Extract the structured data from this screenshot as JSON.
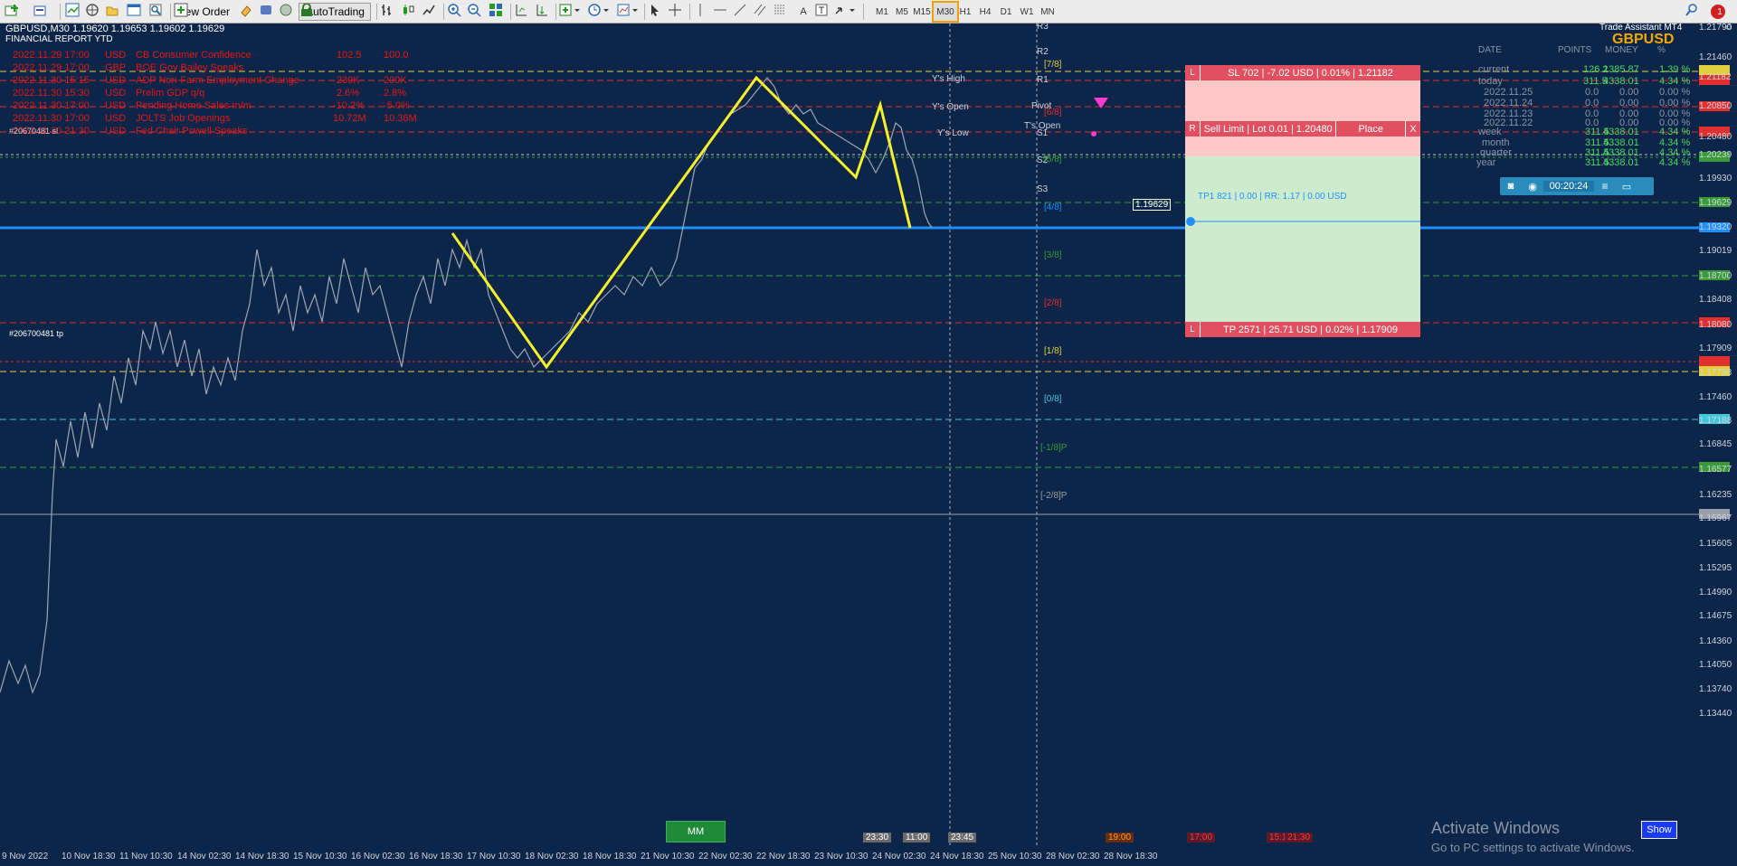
{
  "toolbar": {
    "new_order": "New Order",
    "autotrading": "AutoTrading",
    "timeframes": [
      "M1",
      "M5",
      "M15",
      "M30",
      "H1",
      "H4",
      "D1",
      "W1",
      "MN"
    ],
    "active_timeframe": "M30",
    "badge": "1"
  },
  "chart": {
    "symbol_header": "GBPUSD,M30  1.19620 1.19653 1.19602 1.19629",
    "report_title": "FINANCIAL REPORT YTD",
    "trade_assistant": "Trade Assistant MT4",
    "pair": "GBPUSD",
    "order_label_top": "#20670481 sl",
    "order_label_tp": "#206700481 tp",
    "activate_title": "Activate Windows",
    "activate_sub": "Go to PC settings to activate Windows.",
    "show_button": "Show",
    "mm_button": "MM",
    "current_price": "1.19629"
  },
  "news": [
    {
      "time": "2022.11.29 17:00",
      "currency": "USD",
      "event": "CB Consumer Confidence",
      "actual": "102.5",
      "forecast": "100.0"
    },
    {
      "time": "2022.11.29 17:00",
      "currency": "GBP",
      "event": "BOE Gov Bailey Speaks",
      "actual": "",
      "forecast": ""
    },
    {
      "time": "2022.11.30 15:15",
      "currency": "USD",
      "event": "ADP Non-Farm Employment Change",
      "actual": "239K",
      "forecast": "200K"
    },
    {
      "time": "2022.11.30 15:30",
      "currency": "USD",
      "event": "Prelim GDP q/q",
      "actual": "2.6%",
      "forecast": "2.8%"
    },
    {
      "time": "2022.11.30 17:00",
      "currency": "USD",
      "event": "Pending Home Sales m/m",
      "actual": "-10.2%",
      "forecast": "-5.0%"
    },
    {
      "time": "2022.11.30 17:00",
      "currency": "USD",
      "event": "JOLTS Job Openings",
      "actual": "10.72M",
      "forecast": "10.36M"
    },
    {
      "time": "2022.11.30 21:30",
      "currency": "USD",
      "event": "Fed Chair Powell Speaks",
      "actual": "",
      "forecast": ""
    }
  ],
  "pivots": {
    "r3": "R3",
    "r2": "R2",
    "r1": "R1",
    "pivot": "Pivot",
    "s1": "S1",
    "s2": "S2",
    "s3": "S3",
    "ys_high": "Y's High",
    "ys_open": "Y's Open",
    "ts_open": "T's Open",
    "ys_low": "Y's Low"
  },
  "murrey": [
    "[7/8]",
    "[6/8]",
    "[5/8]",
    "[4/8]",
    "[3/8]",
    "[2/8]",
    "[1/8]",
    "[0/8]",
    "[-1/8]P",
    "[-2/8]P"
  ],
  "trade_panel": {
    "sl_bar": "SL 702 | -7.02 USD | 0.01% | 1.21182",
    "sell_limit": "Sell Limit | Lot 0.01 | 1.20480",
    "place": "Place",
    "close": "X",
    "r": "R",
    "l": "L",
    "tp1": "TP1 821 | 0.00 | RR: 1.17 | 0.00 USD",
    "tp_bar": "TP 2571 | 25.71 USD | 0.02% | 1.17909"
  },
  "stats": {
    "headers": [
      "DATE",
      "POINTS",
      "MONEY",
      "%"
    ],
    "rows": [
      {
        "label": "current",
        "points": "126.2",
        "money": "1385.87",
        "pct": "1.39 %",
        "color": "#4cd964"
      },
      {
        "label": "today",
        "points": "311.5",
        "money": "4338.01",
        "pct": "4.34 %",
        "color": "#4cd964"
      },
      {
        "label": "2022.11.25",
        "points": "0.0",
        "money": "0.00",
        "pct": "0.00 %",
        "color": "#8a96a8"
      },
      {
        "label": "2022.11.24",
        "points": "0.0",
        "money": "0.00",
        "pct": "0.00 %",
        "color": "#8a96a8"
      },
      {
        "label": "2022.11.23",
        "points": "0.0",
        "money": "0.00",
        "pct": "0.00 %",
        "color": "#8a96a8"
      },
      {
        "label": "2022.11.22",
        "points": "0.0",
        "money": "0.00",
        "pct": "0.00 %",
        "color": "#8a96a8"
      },
      {
        "label": "week",
        "points": "311.5",
        "money": "4338.01",
        "pct": "4.34 %",
        "color": "#4cd964"
      },
      {
        "label": "month",
        "points": "311.5",
        "money": "4338.01",
        "pct": "4.34 %",
        "color": "#4cd964"
      },
      {
        "label": "quarter",
        "points": "311.5",
        "money": "4338.01",
        "pct": "4.34 %",
        "color": "#4cd964"
      },
      {
        "label": "year",
        "points": "311.5",
        "money": "4338.01",
        "pct": "4.34 %",
        "color": "#4cd964"
      }
    ],
    "timer": "00:20:24"
  },
  "price_scale": [
    "1.21790",
    "1.21460",
    "1.21182",
    "1.20850",
    "1.20480",
    "1.20239",
    "1.19930",
    "1.19629",
    "1.19320",
    "1.19019",
    "1.18700",
    "1.18408",
    "1.18080",
    "1.17909",
    "1.17798",
    "1.17460",
    "1.17188",
    "1.16845",
    "1.16577",
    "1.16235",
    "1.15967",
    "1.15605",
    "1.15295",
    "1.14990",
    "1.14675",
    "1.14360",
    "1.14050",
    "1.13740",
    "1.13440"
  ],
  "time_axis": [
    "9 Nov 2022",
    "10 Nov 18:30",
    "11 Nov 10:30",
    "14 Nov 02:30",
    "14 Nov 18:30",
    "15 Nov 10:30",
    "16 Nov 02:30",
    "16 Nov 18:30",
    "17 Nov 10:30",
    "18 Nov 02:30",
    "18 Nov 18:30",
    "21 Nov 10:30",
    "22 Nov 02:30",
    "22 Nov 18:30",
    "23 Nov 10:30",
    "24 Nov 02:30",
    "24 Nov 18:30",
    "25 Nov 10:30",
    "28 Nov 02:30",
    "28 Nov 18:30"
  ],
  "session_labels": [
    "23:30",
    "11:00",
    "23:45",
    "19:00",
    "17:00",
    "15:15",
    "21:30"
  ],
  "colors": {
    "background": "#0c2549",
    "zigzag": "#f5f02a",
    "sl_zone": "#ffc7c7",
    "tp_zone": "#cdeccd",
    "bar": "#e05060",
    "blue_line": "#1f8fff"
  }
}
